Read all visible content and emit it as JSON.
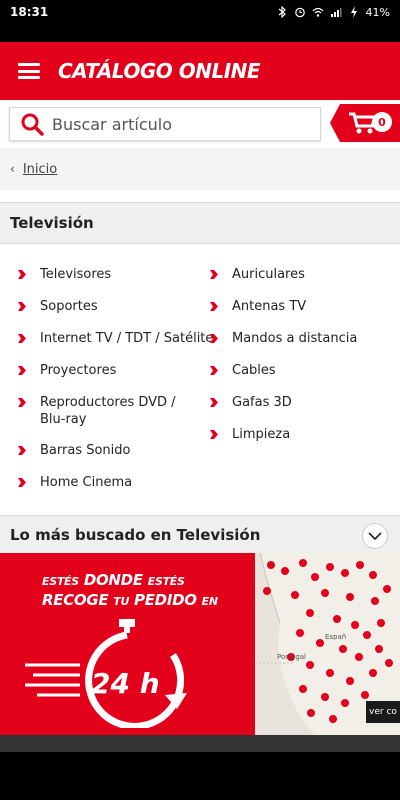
{
  "status_bar": {
    "time": "18:31",
    "battery": "41%"
  },
  "header": {
    "title": "CATÁLOGO ONLINE"
  },
  "search": {
    "placeholder": "Buscar artículo"
  },
  "cart": {
    "count": "0"
  },
  "breadcrumb": {
    "link": "Inicio"
  },
  "section": {
    "title": "Televisión"
  },
  "categories_left": [
    "Televisores",
    "Soportes",
    "Internet TV / TDT / Satélite",
    "Proyectores",
    "Reproductores DVD / Blu-ray",
    "Barras Sonido",
    "Home Cinema"
  ],
  "categories_right": [
    "Auriculares",
    "Antenas TV",
    "Mandos a distancia",
    "Cables",
    "Gafas 3D",
    "Limpieza"
  ],
  "most_searched": {
    "title": "Lo más buscado en Televisión"
  },
  "banner": {
    "line1_a": "ESTÉS",
    "line1_b": "DONDE",
    "line1_c": "ESTÉS",
    "line2_a": "RECOGE",
    "line2_b": "TU",
    "line2_c": "PEDIDO",
    "line2_d": "EN",
    "clock_text": "24 h",
    "map_label_portugal": "Portugal",
    "map_label_espana": "Españ",
    "ver_button": "ver co"
  },
  "colors": {
    "brand": "#e2001a"
  }
}
